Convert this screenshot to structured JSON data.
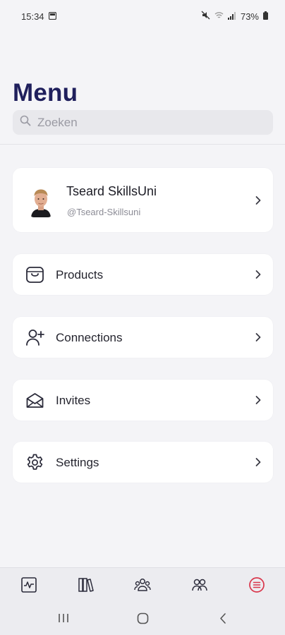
{
  "status_bar": {
    "time": "15:34",
    "battery": "73%"
  },
  "page": {
    "title": "Menu"
  },
  "search": {
    "placeholder": "Zoeken"
  },
  "profile": {
    "name": "Tseard SkillsUni",
    "handle": "@Tseard-Skillsuni"
  },
  "menu": {
    "items": [
      {
        "label": "Products",
        "icon": "shopping-bag-icon"
      },
      {
        "label": "Connections",
        "icon": "add-user-icon"
      },
      {
        "label": "Invites",
        "icon": "envelope-icon"
      },
      {
        "label": "Settings",
        "icon": "gear-icon"
      }
    ]
  },
  "tab_bar": {
    "tabs": [
      "activity-icon",
      "library-icon",
      "community-icon",
      "people-icon",
      "menu-list-icon"
    ],
    "active_tab": "menu-list-icon",
    "active_color": "#d9354a"
  },
  "colors": {
    "title": "#1f1f5c",
    "background": "#f4f4f7",
    "card": "#ffffff"
  }
}
